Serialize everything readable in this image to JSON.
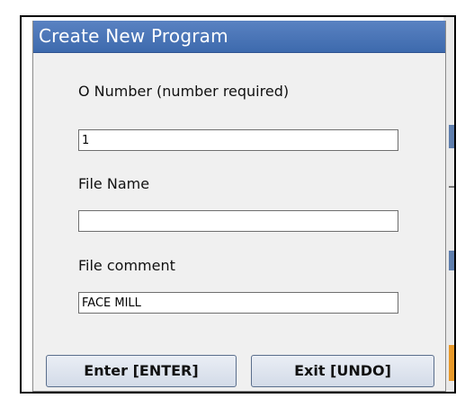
{
  "dialog": {
    "title": "Create New Program",
    "fields": {
      "o_number": {
        "label": "O Number (number required)",
        "value": "1"
      },
      "file_name": {
        "label": "File Name",
        "value": ""
      },
      "file_comment": {
        "label": "File comment",
        "value": "FACE MILL"
      }
    },
    "buttons": {
      "enter_label": "Enter [ENTER]",
      "exit_label": "Exit [UNDO]"
    }
  },
  "colors": {
    "titlebar": "#3d6aad",
    "title_text": "#ffffff",
    "dialog_bg": "#f0f0f0",
    "button_bg": "#dbe2ee"
  }
}
